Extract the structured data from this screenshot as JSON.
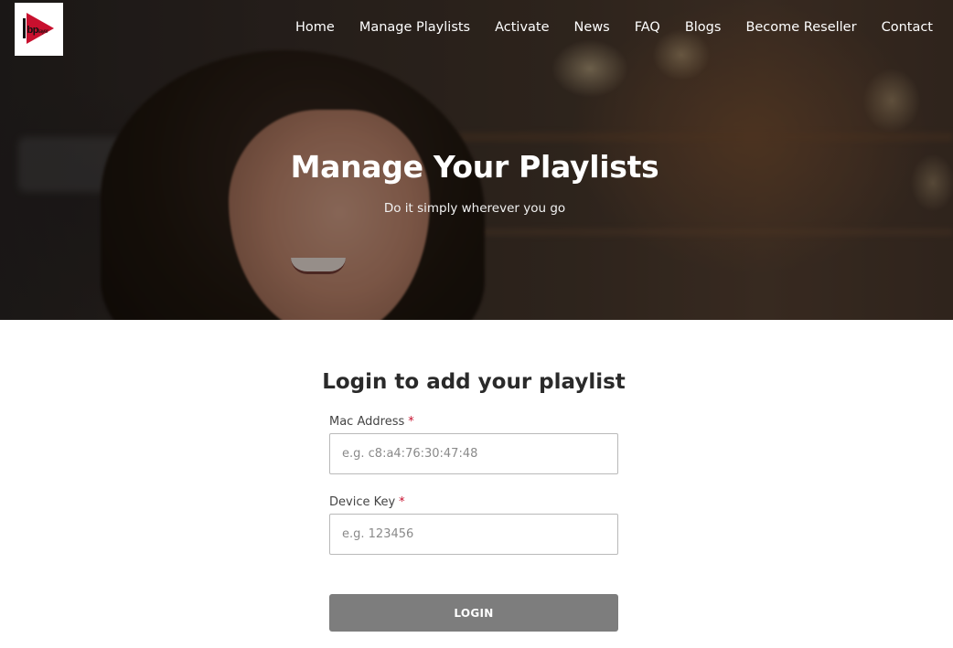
{
  "logo": {
    "text": "bp",
    "small_text": "layer"
  },
  "nav": {
    "items": [
      {
        "label": "Home"
      },
      {
        "label": "Manage Playlists"
      },
      {
        "label": "Activate"
      },
      {
        "label": "News"
      },
      {
        "label": "FAQ"
      },
      {
        "label": "Blogs"
      },
      {
        "label": "Become Reseller"
      },
      {
        "label": "Contact"
      }
    ]
  },
  "hero": {
    "title": "Manage Your Playlists",
    "subtitle": "Do it simply wherever you go"
  },
  "login_form": {
    "title": "Login to add your playlist",
    "mac_address": {
      "label": "Mac Address",
      "required_mark": "*",
      "placeholder": "e.g. c8:a4:76:30:47:48",
      "value": ""
    },
    "device_key": {
      "label": "Device Key",
      "required_mark": "*",
      "placeholder": "e.g. 123456",
      "value": ""
    },
    "submit_label": "LOGIN"
  },
  "colors": {
    "brand_red": "#c8102e",
    "button_gray": "#7d7d7d"
  }
}
